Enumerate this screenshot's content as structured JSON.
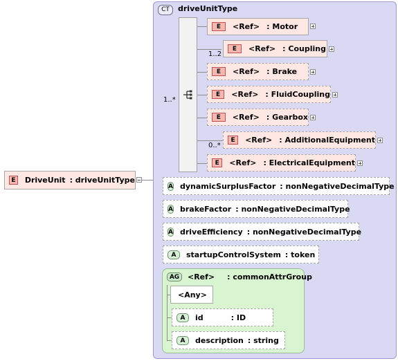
{
  "complex_type": {
    "badge": "CT",
    "name": "driveUnitType"
  },
  "root_element": {
    "badge": "E",
    "label": "DriveUnit",
    "type": ": driveUnitType"
  },
  "sequence": {
    "cardinality": "1..*"
  },
  "children": [
    {
      "badge": "E",
      "ref": "<Ref>",
      "name": ": Motor",
      "cardinality": ""
    },
    {
      "badge": "E",
      "ref": "<Ref>",
      "name": ": Coupling",
      "cardinality": "1..2"
    },
    {
      "badge": "E",
      "ref": "<Ref>",
      "name": ": Brake",
      "cardinality": ""
    },
    {
      "badge": "E",
      "ref": "<Ref>",
      "name": ": FluidCoupling",
      "cardinality": ""
    },
    {
      "badge": "E",
      "ref": "<Ref>",
      "name": ": Gearbox",
      "cardinality": ""
    },
    {
      "badge": "E",
      "ref": "<Ref>",
      "name": ": AdditionalEquipment",
      "cardinality": "0..*"
    },
    {
      "badge": "E",
      "ref": "<Ref>",
      "name": ": ElectricalEquipment",
      "cardinality": ""
    }
  ],
  "attributes": [
    {
      "badge": "A",
      "name": "dynamicSurplusFactor",
      "type": ": nonNegativeDecimalType"
    },
    {
      "badge": "A",
      "name": "brakeFactor",
      "type": ": nonNegativeDecimalType"
    },
    {
      "badge": "A",
      "name": "driveEfficiency",
      "type": ": nonNegativeDecimalType"
    },
    {
      "badge": "A",
      "name": "startupControlSystem",
      "type": ": token"
    }
  ],
  "attribute_group": {
    "badge": "AG",
    "ref": "<Ref>",
    "name": ": commonAttrGroup",
    "any": "<Any>",
    "attributes": [
      {
        "badge": "A",
        "name": "id",
        "type": ": ID"
      },
      {
        "badge": "A",
        "name": "description",
        "type": ": string"
      }
    ]
  }
}
